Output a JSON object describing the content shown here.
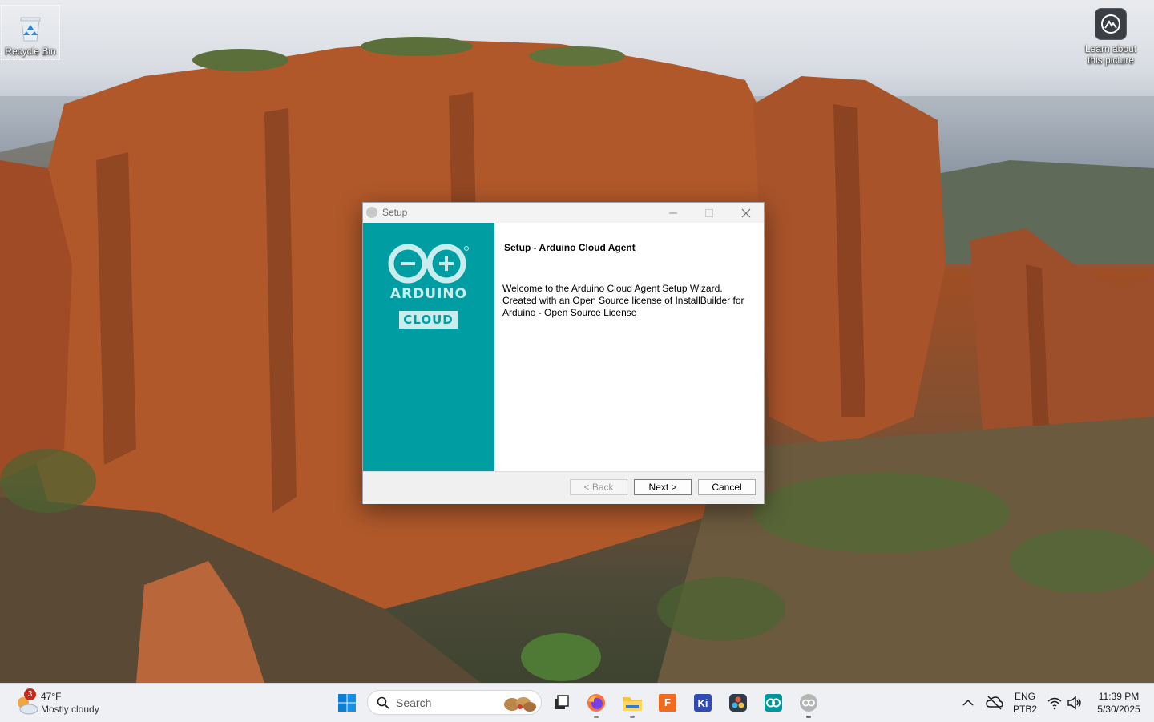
{
  "desktop": {
    "icons": [
      {
        "label": "Recycle Bin"
      },
      {
        "label_line1": "Learn about",
        "label_line2": "this picture"
      }
    ]
  },
  "setup_window": {
    "title": "Setup",
    "heading": "Setup - Arduino Cloud Agent",
    "welcome_text": "Welcome to the Arduino Cloud Agent Setup Wizard. Created with an Open Source license of InstallBuilder for Arduino - Open Source License",
    "logo": {
      "line1": "ARDUINO",
      "line2": "CLOUD"
    },
    "buttons": {
      "back": "< Back",
      "next": "Next >",
      "cancel": "Cancel"
    }
  },
  "taskbar": {
    "weather": {
      "badge": "3",
      "temp": "47°F",
      "condition": "Mostly cloudy"
    },
    "search_placeholder": "Search",
    "apps": [
      "windows-start",
      "search",
      "task-view",
      "firefox",
      "file-explorer",
      "fusion",
      "kicad",
      "davinci-resolve",
      "arduino-ide",
      "arduino-setup"
    ],
    "tray": {
      "lang_top": "ENG",
      "lang_bottom": "PTB2",
      "time": "11:39 PM",
      "date": "5/30/2025"
    }
  },
  "colors": {
    "arduino_teal": "#009da2",
    "taskbar": "#eef0f3",
    "accent_blue": "#0067c0"
  }
}
